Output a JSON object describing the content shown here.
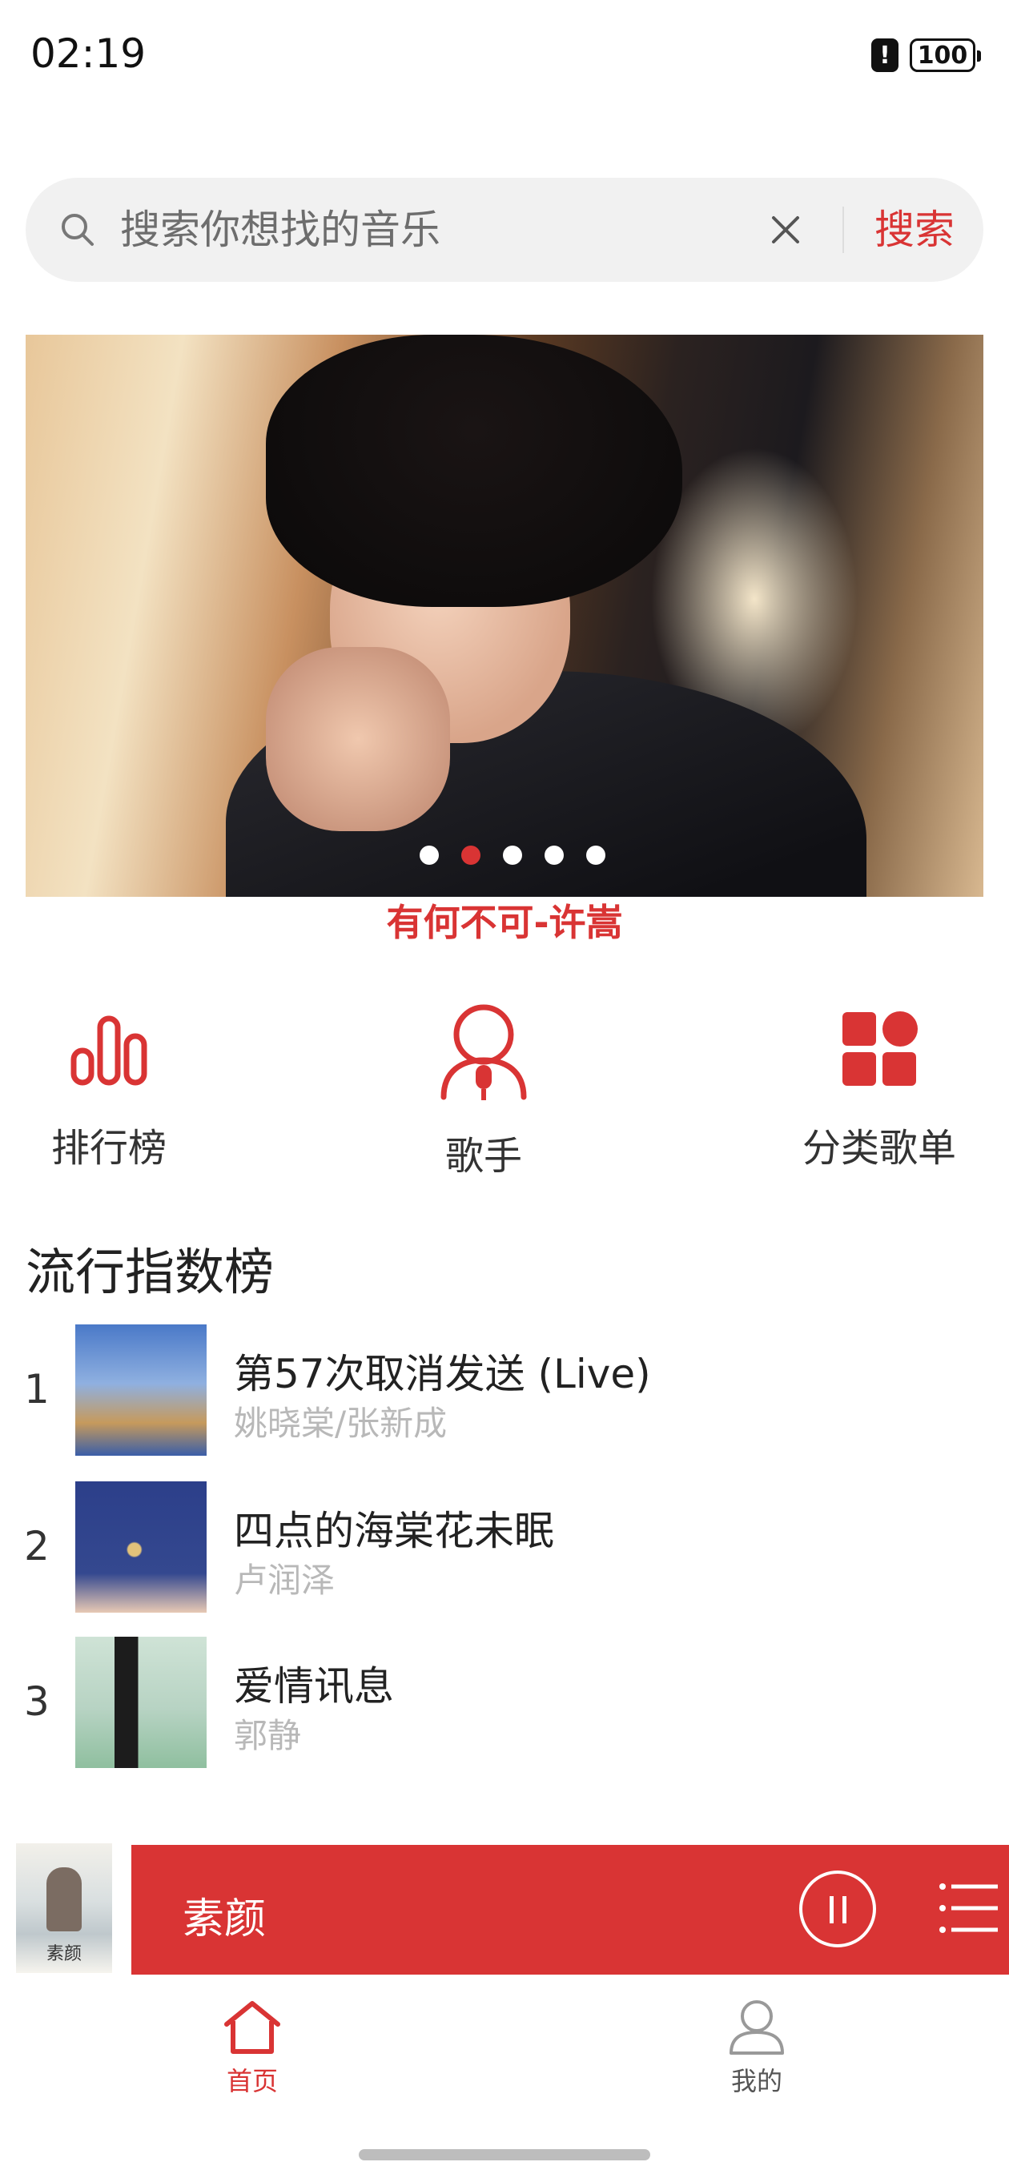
{
  "status_bar": {
    "time": "02:19",
    "battery": "100",
    "alert": "!"
  },
  "search": {
    "placeholder": "搜索你想找的音乐",
    "button_label": "搜索"
  },
  "banner": {
    "caption": "有何不可-许嵩",
    "dot_count": 5,
    "active_dot": 1
  },
  "categories": [
    {
      "label": "排行榜",
      "icon": "bar-chart-icon"
    },
    {
      "label": "歌手",
      "icon": "singer-icon"
    },
    {
      "label": "分类歌单",
      "icon": "grid-icon"
    }
  ],
  "section": {
    "title": "流行指数榜"
  },
  "tracks": [
    {
      "rank": "1",
      "title": "第57次取消发送 (Live)",
      "artist": "姚晓棠/张新成",
      "cover_colors": [
        "#4a79c8",
        "#c69a5c"
      ]
    },
    {
      "rank": "2",
      "title": "四点的海棠花未眠",
      "artist": "卢润泽",
      "cover_colors": [
        "#2c3f8a",
        "#e8c9b4"
      ]
    },
    {
      "rank": "3",
      "title": "爱情讯息",
      "artist": "郭静",
      "cover_colors": [
        "#cfe3d6",
        "#1c1c1c"
      ]
    }
  ],
  "player": {
    "title": "素颜",
    "cover_text": "素颜"
  },
  "tabs": [
    {
      "label": "首页",
      "icon": "home-icon",
      "active": true
    },
    {
      "label": "我的",
      "icon": "user-icon",
      "active": false
    }
  ],
  "colors": {
    "accent": "#d93434",
    "muted_text": "#b8b8b8",
    "search_bg": "#f1f1f1"
  }
}
